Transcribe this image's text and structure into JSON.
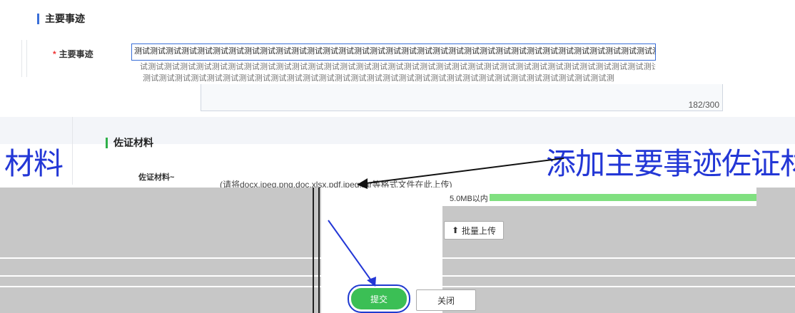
{
  "section_main": {
    "title": "主要事迹",
    "field_label": "主要事迹",
    "required_star": "*",
    "text_line1": "测试测试测试测试测试测试测试测试测试测试测试测试测试测试测试测试测试测试测试测试测试测试测试测试测试测试测试测试测试测试测试测试测试测试测试测试测",
    "text_line2": "试测试测试测试测试测试测试测试测试测试测试测试测试测试测试测试测试测试测试测试测试测试测试测试测试测试测试测试测试测试测试测试测试测试测试测试测试",
    "text_line3": "测试测试测试测试测试测试测试测试测试测试测试测试测试测试测试测试测试测试测试测试测试测试测试测试测试测试测试测试测试测试测试测试",
    "counter": "182/300"
  },
  "section_evidence": {
    "title": "佐证材料",
    "field_label": "佐证材料~",
    "hint": "(请将docx,jpeg,png,doc,xlsx,pdf,jpeg,rar等格式文件在此上传)",
    "size_hint": "5.0MB以内",
    "upload_button": "批量上传",
    "upload_icon": "upload-icon"
  },
  "overlay": {
    "left_text": "材料",
    "right_text": "添加主要事迹佐证材"
  },
  "footer": {
    "submit_button": "提交",
    "close_button": "关闭"
  },
  "colors": {
    "accent_blue": "#3a6fd8",
    "annotation_blue": "#1f3ad0",
    "submit_green": "#3bbf55"
  }
}
